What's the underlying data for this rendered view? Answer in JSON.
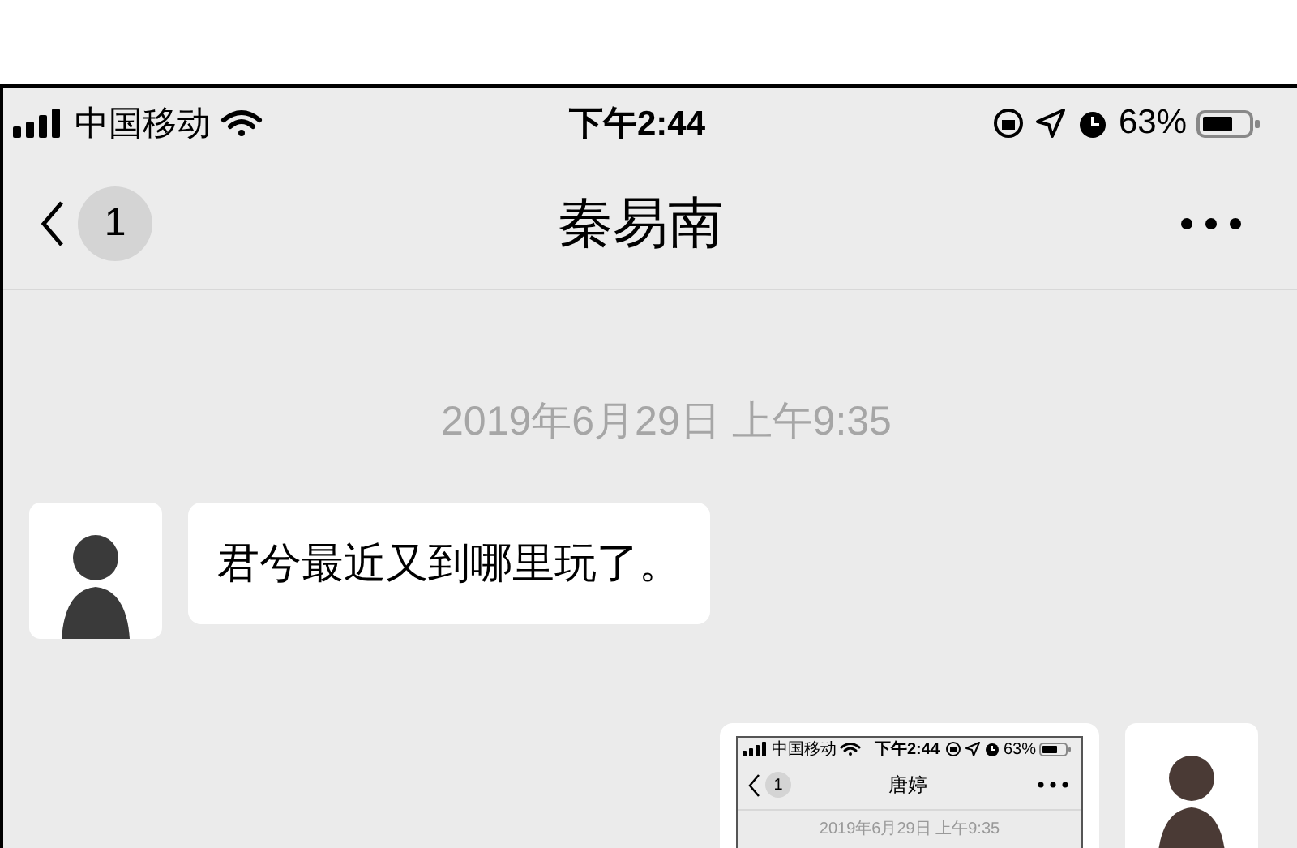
{
  "status_bar": {
    "carrier": "中国移动",
    "time": "下午2:44",
    "battery": "63%"
  },
  "nav": {
    "back_badge": "1",
    "title": "秦易南"
  },
  "messages": [
    {
      "kind": "timestamp",
      "text": "2019年6月29日 上午9:35"
    },
    {
      "kind": "incoming_text",
      "text": "君兮最近又到哪里玩了。"
    },
    {
      "kind": "outgoing_screenshot",
      "screen": {
        "status_bar": {
          "carrier": "中国移动",
          "time": "下午2:44",
          "battery": "63%"
        },
        "nav": {
          "back_badge": "1",
          "title": "唐婷"
        },
        "timestamp": "2019年6月29日 上午9:35"
      }
    }
  ]
}
